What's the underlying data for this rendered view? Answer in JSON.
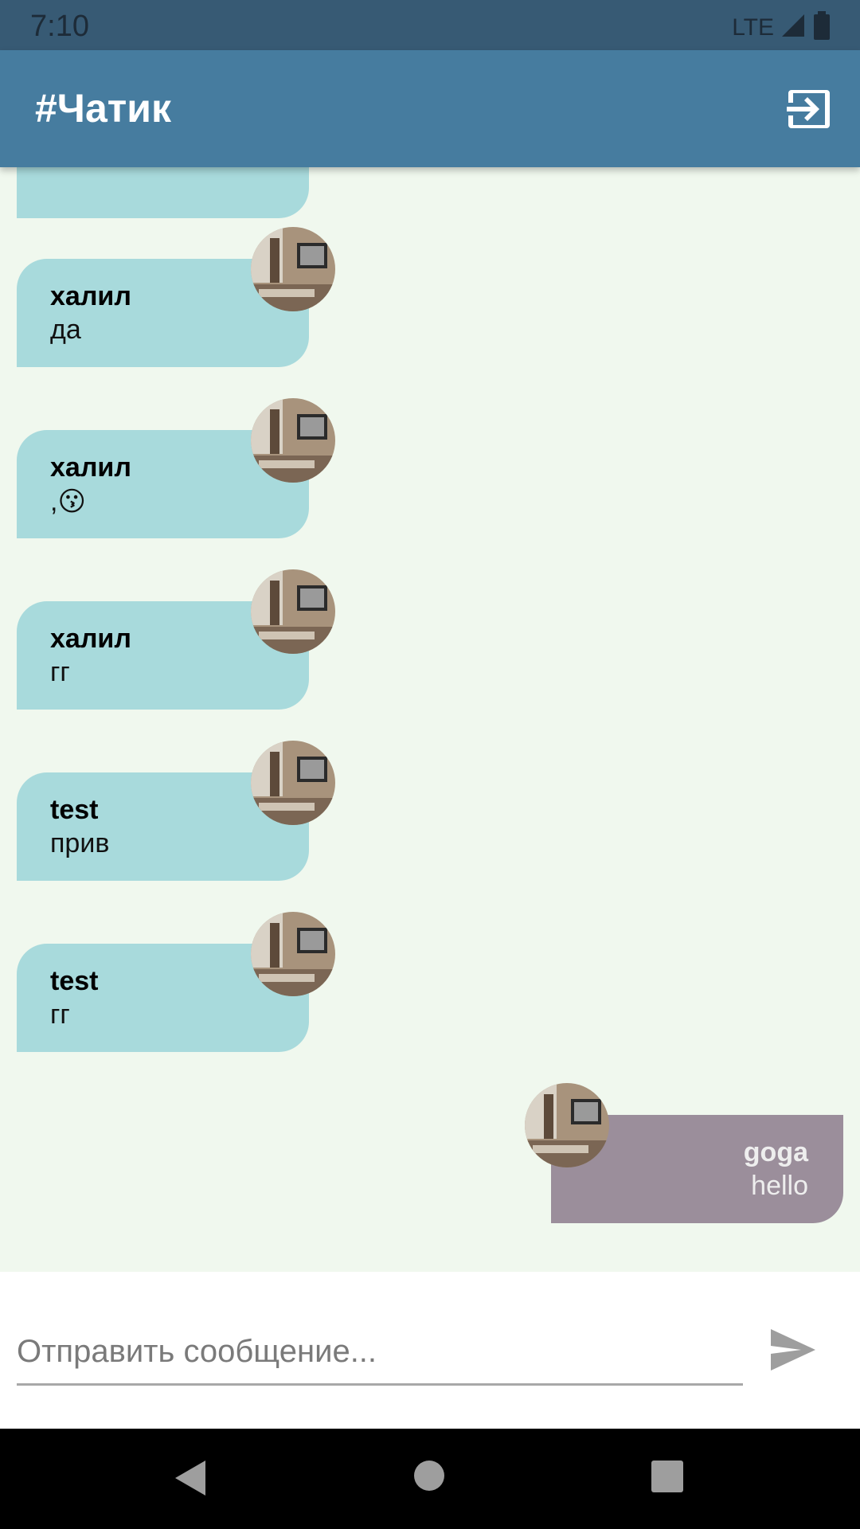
{
  "status_bar": {
    "time": "7:10",
    "network": "LTE"
  },
  "app_bar": {
    "title": "#Чатик",
    "logout_icon": "logout-icon"
  },
  "colors": {
    "status_bar": "#375a74",
    "app_bar": "#467c9f",
    "background": "#f0f8ee",
    "incoming_bubble": "#a8dadc",
    "outgoing_bubble": "#9b8e9b"
  },
  "messages": [
    {
      "author": "халил",
      "text": "да",
      "direction": "incoming"
    },
    {
      "author": "халил",
      "text": ",😗",
      "direction": "incoming"
    },
    {
      "author": "халил",
      "text": "гг",
      "direction": "incoming"
    },
    {
      "author": "test",
      "text": "прив",
      "direction": "incoming"
    },
    {
      "author": "test",
      "text": "гг",
      "direction": "incoming"
    },
    {
      "author": "goga",
      "text": "hello",
      "direction": "outgoing"
    }
  ],
  "composer": {
    "placeholder": "Отправить сообщение...",
    "value": "",
    "send_icon": "send-icon"
  },
  "nav": {
    "back_icon": "back-icon",
    "home_icon": "home-icon",
    "recents_icon": "recents-icon"
  }
}
